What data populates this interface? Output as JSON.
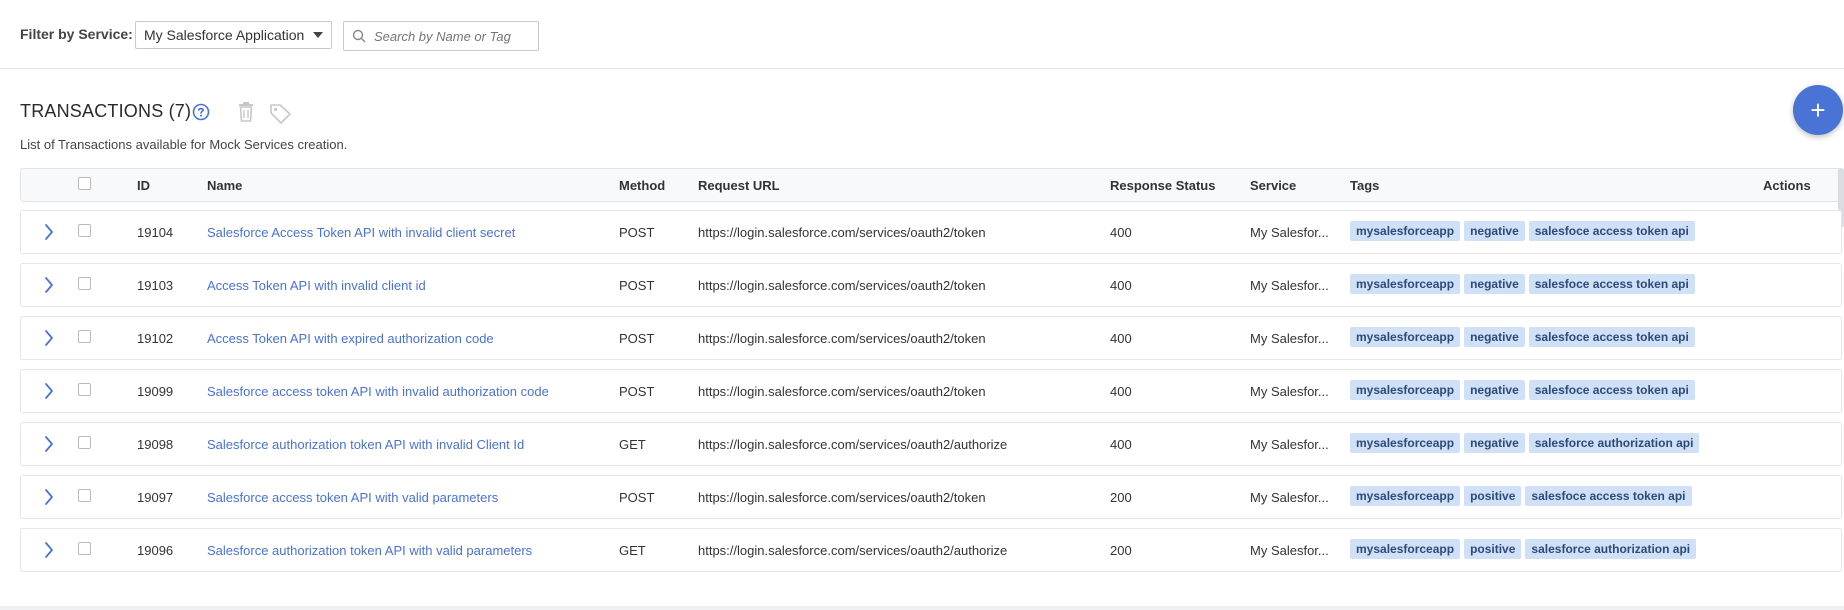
{
  "filter": {
    "label": "Filter by Service:",
    "selected_service": "My Salesforce Application",
    "search_placeholder": "Search by Name or Tag"
  },
  "section": {
    "title": "TRANSACTIONS (7)",
    "subtitle": "List of Transactions available for Mock Services creation."
  },
  "fab": {
    "label": "+"
  },
  "table": {
    "columns": {
      "id": "ID",
      "name": "Name",
      "method": "Method",
      "request_url": "Request URL",
      "response_status": "Response Status",
      "service": "Service",
      "tags": "Tags",
      "actions": "Actions"
    },
    "rows": [
      {
        "id": "19104",
        "name": "Salesforce Access Token API with invalid client secret",
        "method": "POST",
        "url": "https://login.salesforce.com/services/oauth2/token",
        "status": "400",
        "service": "My Salesfor...",
        "tags": [
          "mysalesforceapp",
          "negative",
          "salesfoce access token api"
        ]
      },
      {
        "id": "19103",
        "name": "Access Token API with invalid client id",
        "method": "POST",
        "url": "https://login.salesforce.com/services/oauth2/token",
        "status": "400",
        "service": "My Salesfor...",
        "tags": [
          "mysalesforceapp",
          "negative",
          "salesfoce access token api"
        ]
      },
      {
        "id": "19102",
        "name": "Access Token API with expired authorization code",
        "method": "POST",
        "url": "https://login.salesforce.com/services/oauth2/token",
        "status": "400",
        "service": "My Salesfor...",
        "tags": [
          "mysalesforceapp",
          "negative",
          "salesfoce access token api"
        ]
      },
      {
        "id": "19099",
        "name": "Salesforce access token API with invalid authorization code",
        "method": "POST",
        "url": "https://login.salesforce.com/services/oauth2/token",
        "status": "400",
        "service": "My Salesfor...",
        "tags": [
          "mysalesforceapp",
          "negative",
          "salesfoce access token api"
        ]
      },
      {
        "id": "19098",
        "name": "Salesforce authorization token API with invalid Client Id",
        "method": "GET",
        "url": "https://login.salesforce.com/services/oauth2/authorize",
        "status": "400",
        "service": "My Salesfor...",
        "tags": [
          "mysalesforceapp",
          "negative",
          "salesforce authorization api"
        ]
      },
      {
        "id": "19097",
        "name": "Salesforce access token API with valid parameters",
        "method": "POST",
        "url": "https://login.salesforce.com/services/oauth2/token",
        "status": "200",
        "service": "My Salesfor...",
        "tags": [
          "mysalesforceapp",
          "positive",
          "salesfoce access token api"
        ]
      },
      {
        "id": "19096",
        "name": "Salesforce authorization token API with valid parameters",
        "method": "GET",
        "url": "https://login.salesforce.com/services/oauth2/authorize",
        "status": "200",
        "service": "My Salesfor...",
        "tags": [
          "mysalesforceapp",
          "positive",
          "salesforce authorization api"
        ]
      }
    ]
  },
  "icons": {
    "help": "question-circle-icon",
    "delete": "trash-icon",
    "tag": "tag-icon",
    "expand": "chevron-right-icon",
    "search": "search-icon",
    "dropdown": "caret-down-icon"
  },
  "colors": {
    "accent": "#4a73d6",
    "link": "#4a72d0",
    "tag_bg": "#cfe0f7",
    "tag_text": "#2d4b7a"
  }
}
